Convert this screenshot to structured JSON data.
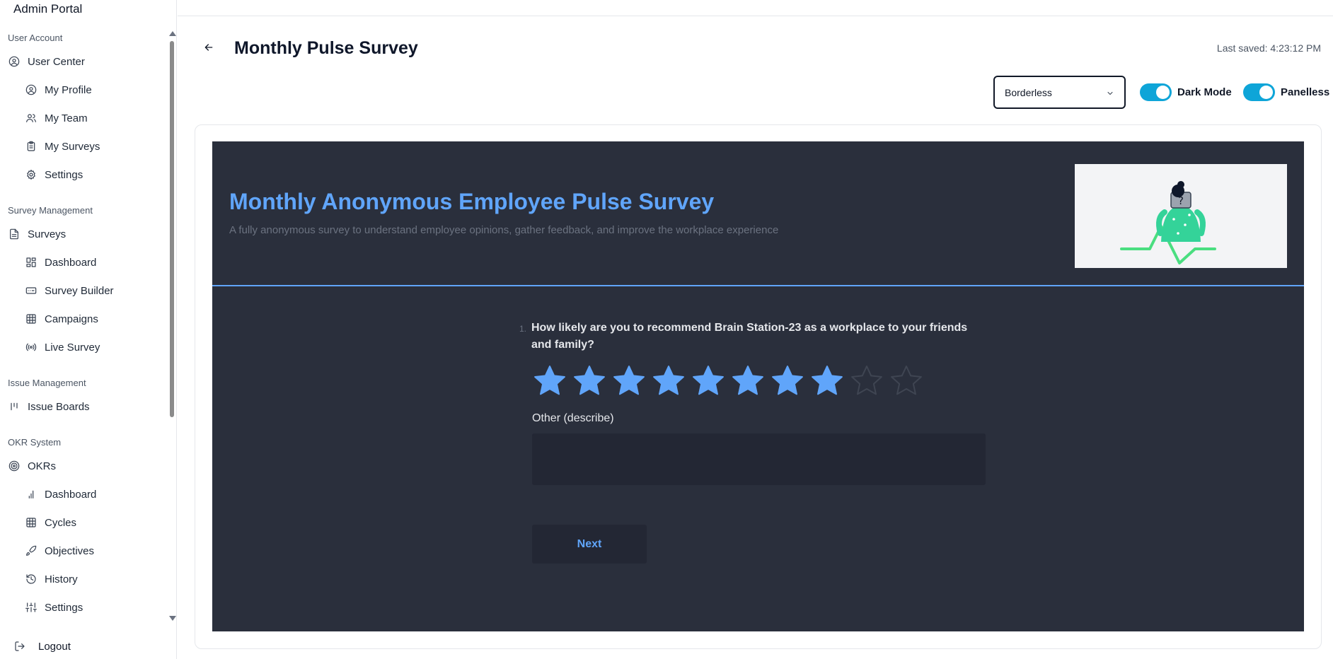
{
  "app": {
    "brand": "Admin Portal"
  },
  "sidebar": {
    "sections": [
      {
        "title": "User Account"
      },
      {
        "title": "Survey Management"
      },
      {
        "title": "Issue Management"
      },
      {
        "title": "OKR System"
      }
    ],
    "items": [
      {
        "label": "User Center",
        "icon": "user-circle-icon"
      },
      {
        "label": "My Profile",
        "icon": "user-circle-icon"
      },
      {
        "label": "My Team",
        "icon": "users-icon"
      },
      {
        "label": "My Surveys",
        "icon": "clipboard-icon"
      },
      {
        "label": "Settings",
        "icon": "gear-icon"
      },
      {
        "label": "Surveys",
        "icon": "file-icon"
      },
      {
        "label": "Dashboard",
        "icon": "layout-icon"
      },
      {
        "label": "Survey Builder",
        "icon": "form-icon"
      },
      {
        "label": "Campaigns",
        "icon": "grid-icon"
      },
      {
        "label": "Live Survey",
        "icon": "broadcast-icon"
      },
      {
        "label": "Issue Boards",
        "icon": "kanban-icon"
      },
      {
        "label": "OKRs",
        "icon": "target-icon"
      },
      {
        "label": "Dashboard",
        "icon": "bar-chart-icon"
      },
      {
        "label": "Cycles",
        "icon": "grid-icon"
      },
      {
        "label": "Objectives",
        "icon": "rocket-icon"
      },
      {
        "label": "History",
        "icon": "history-icon"
      },
      {
        "label": "Settings",
        "icon": "sliders-icon"
      }
    ],
    "logout_label": "Logout"
  },
  "header": {
    "title": "Monthly Pulse Survey",
    "last_saved": "Last saved: 4:23:12 PM",
    "theme_select": {
      "value": "Borderless"
    },
    "toggles": [
      {
        "label": "Dark Mode",
        "on": true
      },
      {
        "label": "Panelless",
        "on": true
      }
    ]
  },
  "survey": {
    "title": "Monthly Anonymous Employee Pulse Survey",
    "description": "A fully anonymous survey to understand employee opinions, gather feedback, and improve the workplace experience",
    "question": {
      "number": "1.",
      "text": "How likely are you to recommend Brain Station-23 as a workplace to your friends and family?",
      "rating_max": 10,
      "rating_value": 8,
      "other_label": "Other (describe)",
      "other_value": ""
    },
    "next_label": "Next"
  },
  "colors": {
    "accent": "#60a5fa",
    "toggle_on": "#0ea5d8",
    "survey_bg": "#2a2f3c",
    "star_empty_stroke": "#3f4552"
  }
}
